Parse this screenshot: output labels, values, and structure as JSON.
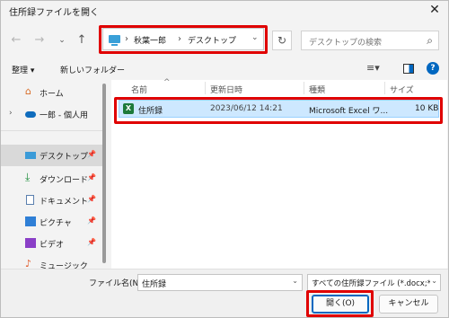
{
  "window": {
    "title": "住所録ファイルを開く"
  },
  "address": {
    "crumbs": [
      "秋葉一郎",
      "デスクトップ"
    ],
    "search_placeholder": "デスクトップの検索"
  },
  "toolbar": {
    "organize": "整理 ▾",
    "new_folder": "新しいフォルダー"
  },
  "nav": {
    "items": [
      {
        "label": "ホーム",
        "icon": "home-icon"
      },
      {
        "label": "一郎 - 個人用",
        "icon": "onedrive-cloud-icon"
      },
      {
        "label": "デスクトップ",
        "icon": "desktop-icon",
        "selected": true
      },
      {
        "label": "ダウンロード",
        "icon": "download-icon"
      },
      {
        "label": "ドキュメント",
        "icon": "document-icon"
      },
      {
        "label": "ピクチャ",
        "icon": "pictures-icon"
      },
      {
        "label": "ビデオ",
        "icon": "video-icon"
      },
      {
        "label": "ミュージック",
        "icon": "music-icon"
      }
    ]
  },
  "list": {
    "columns": [
      "名前",
      "更新日時",
      "種類",
      "サイズ"
    ],
    "rows": [
      {
        "name": "住所録",
        "modified": "2023/06/12 14:21",
        "type": "Microsoft Excel ワ...",
        "size": "10 KB",
        "icon": "excel-file-icon"
      }
    ]
  },
  "bottom": {
    "filename_label": "ファイル名(N):",
    "filename_value": "住所録",
    "filter_value": "すべての住所録ファイル (*.docx;*.c",
    "open_label": "開く(O)",
    "cancel_label": "キャンセル"
  },
  "colors": {
    "highlight": "#e00000",
    "selection": "#cde8ff",
    "accent": "#0067c0"
  }
}
